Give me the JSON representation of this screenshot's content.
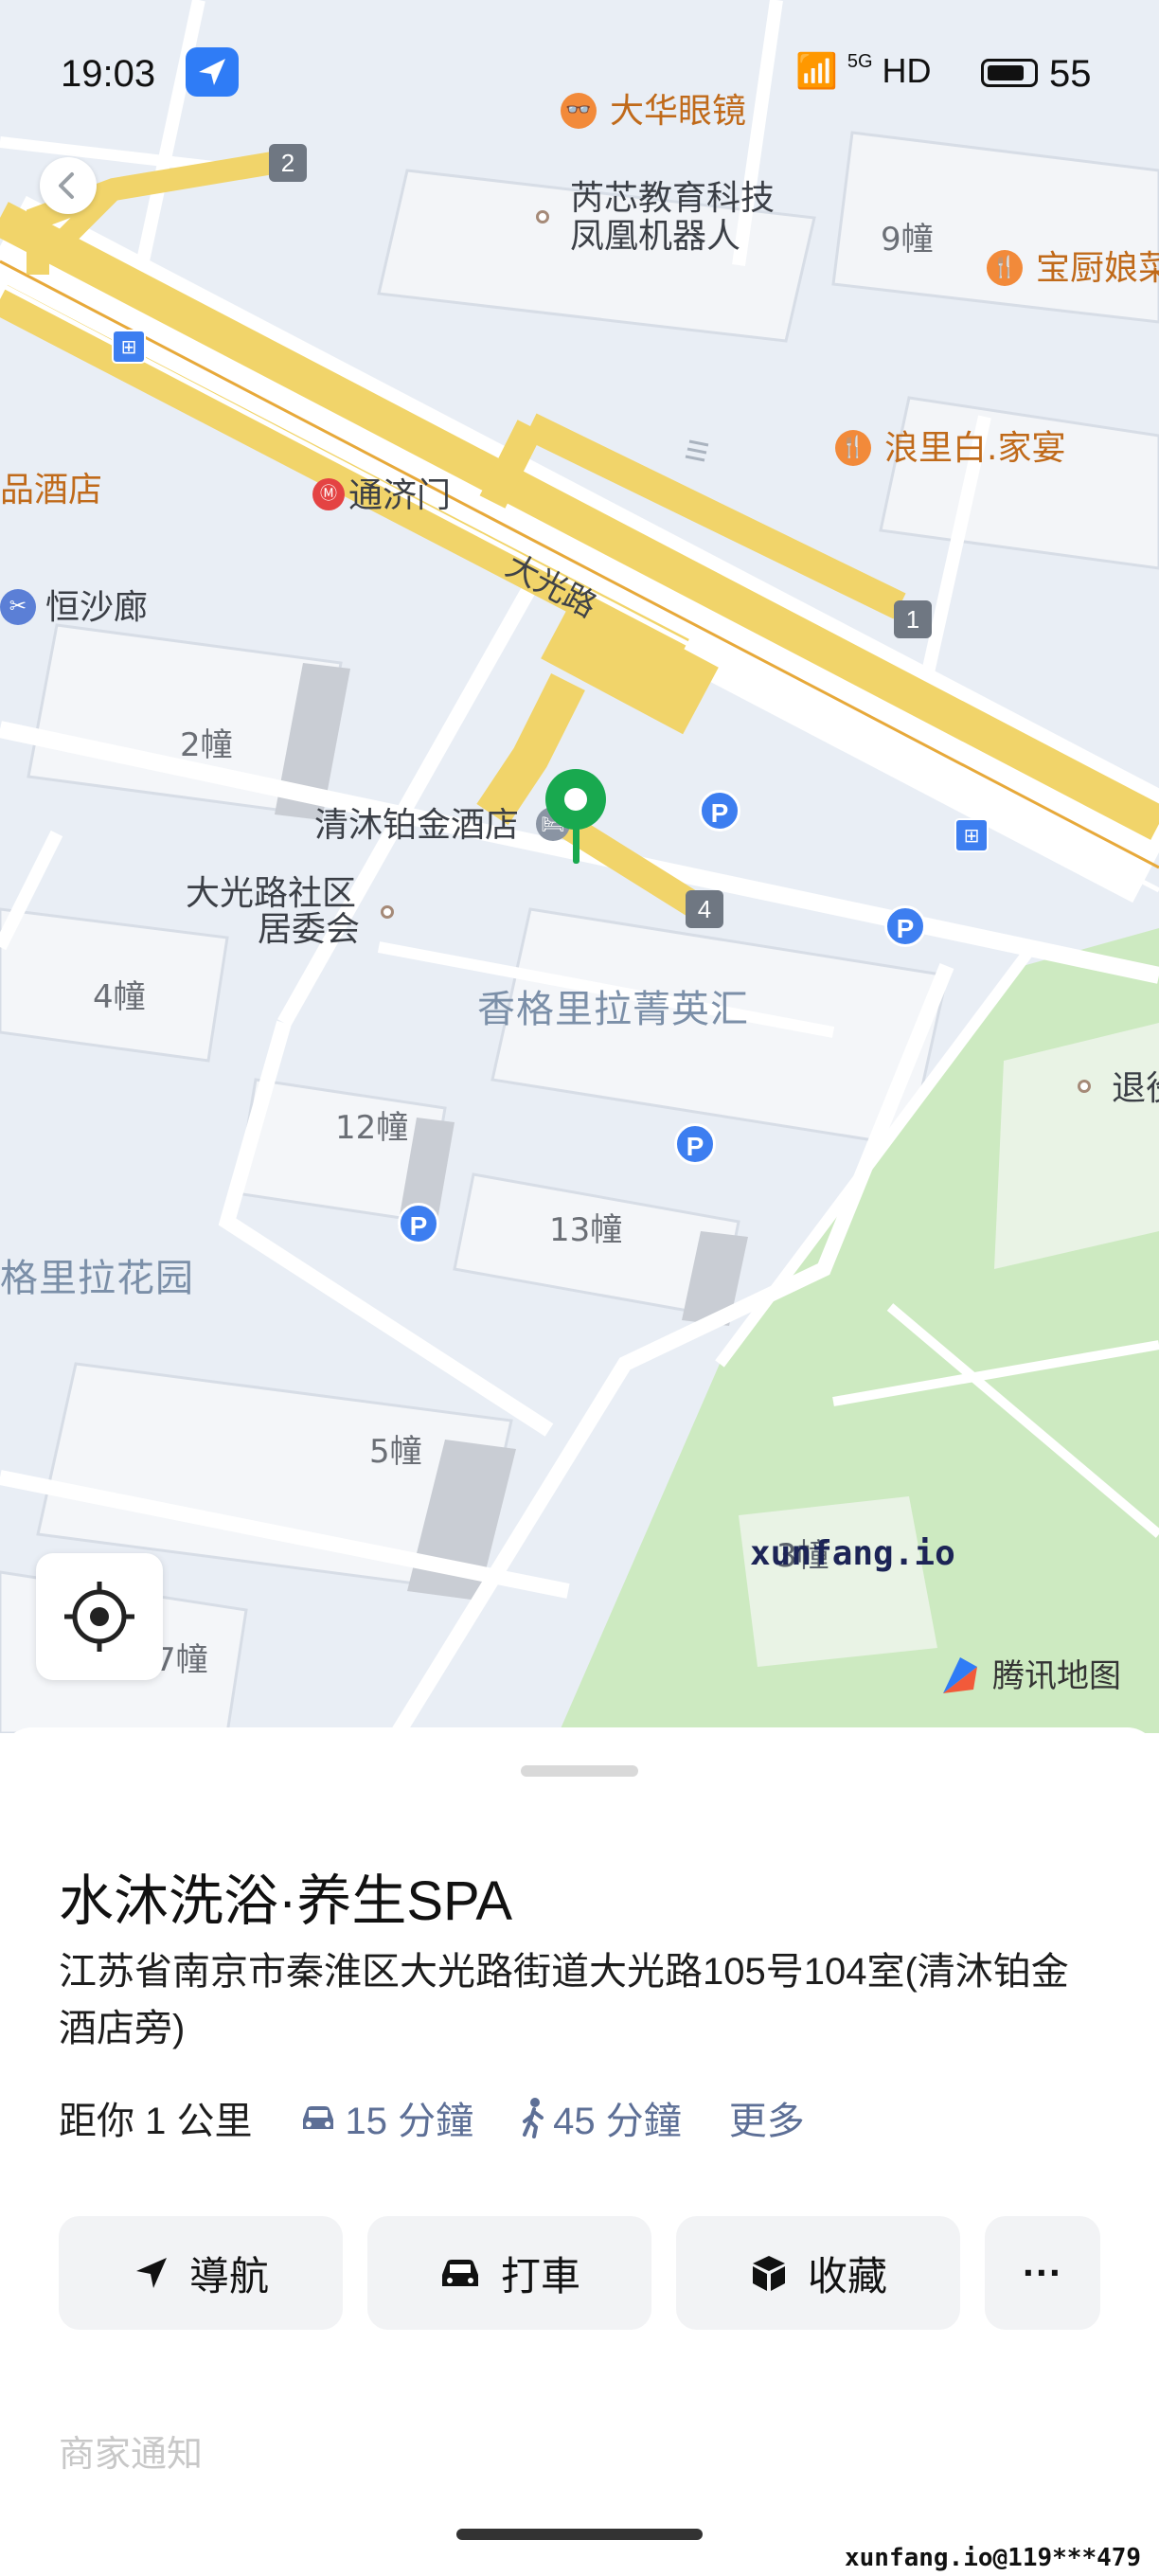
{
  "status_bar": {
    "time": "19:03",
    "network": "5G",
    "hd": "HD",
    "battery": "55"
  },
  "map": {
    "labels": {
      "dahua": "大华眼镜",
      "ruixin1": "芮芯教育科技",
      "ruixin2": "凤凰机器人",
      "b9": "9幢",
      "baochu": "宝厨娘菜",
      "langli": "浪里白.家宴",
      "pinjiudian": "品酒店",
      "tongjimen": "通济门",
      "dagl": "大光路",
      "hengshalang": "恒沙廊",
      "b2": "2幢",
      "qingmu": "清沐铂金酒店",
      "jwh1": "大光路社区",
      "jwh2": "居委会",
      "b4": "4幢",
      "xgll": "香格里拉菁英汇",
      "tui": "退役",
      "b12": "12幢",
      "b13": "13幢",
      "xgllhy": "格里拉花园",
      "b5": "5幢",
      "b7": "7幢",
      "b3": "3幢",
      "tencent": "腾讯地图"
    },
    "badges": {
      "n2": "2",
      "n1": "1",
      "n4": "4",
      "p": "P"
    },
    "watermark": "xunfang.io"
  },
  "sheet": {
    "title": "水沐洗浴·养生SPA",
    "address": "江苏省南京市秦淮区大光路街道大光路105号104室(清沐铂金酒店旁)",
    "distance": "距你 1 公里",
    "drive": "15 分鐘",
    "walk": "45 分鐘",
    "more": "更多",
    "actions": {
      "navigate": "導航",
      "taxi": "打車",
      "favorite": "收藏",
      "more": "···"
    },
    "faded_text": "商家通知"
  },
  "footer_watermark": "xunfang.io@119***479",
  "colors": {
    "accent": "#2f7cf6",
    "pin": "#19a94f",
    "road_yellow": "#f1d46a",
    "park_green": "#cdeac1"
  },
  "icons": {
    "location_arrow": "location-arrow-icon",
    "back": "chevron-left-icon",
    "locate": "crosshair-icon",
    "car": "car-icon",
    "walk": "walk-icon",
    "navigate": "navigation-arrow-icon",
    "taxi": "taxi-icon",
    "favorite": "box-icon"
  }
}
